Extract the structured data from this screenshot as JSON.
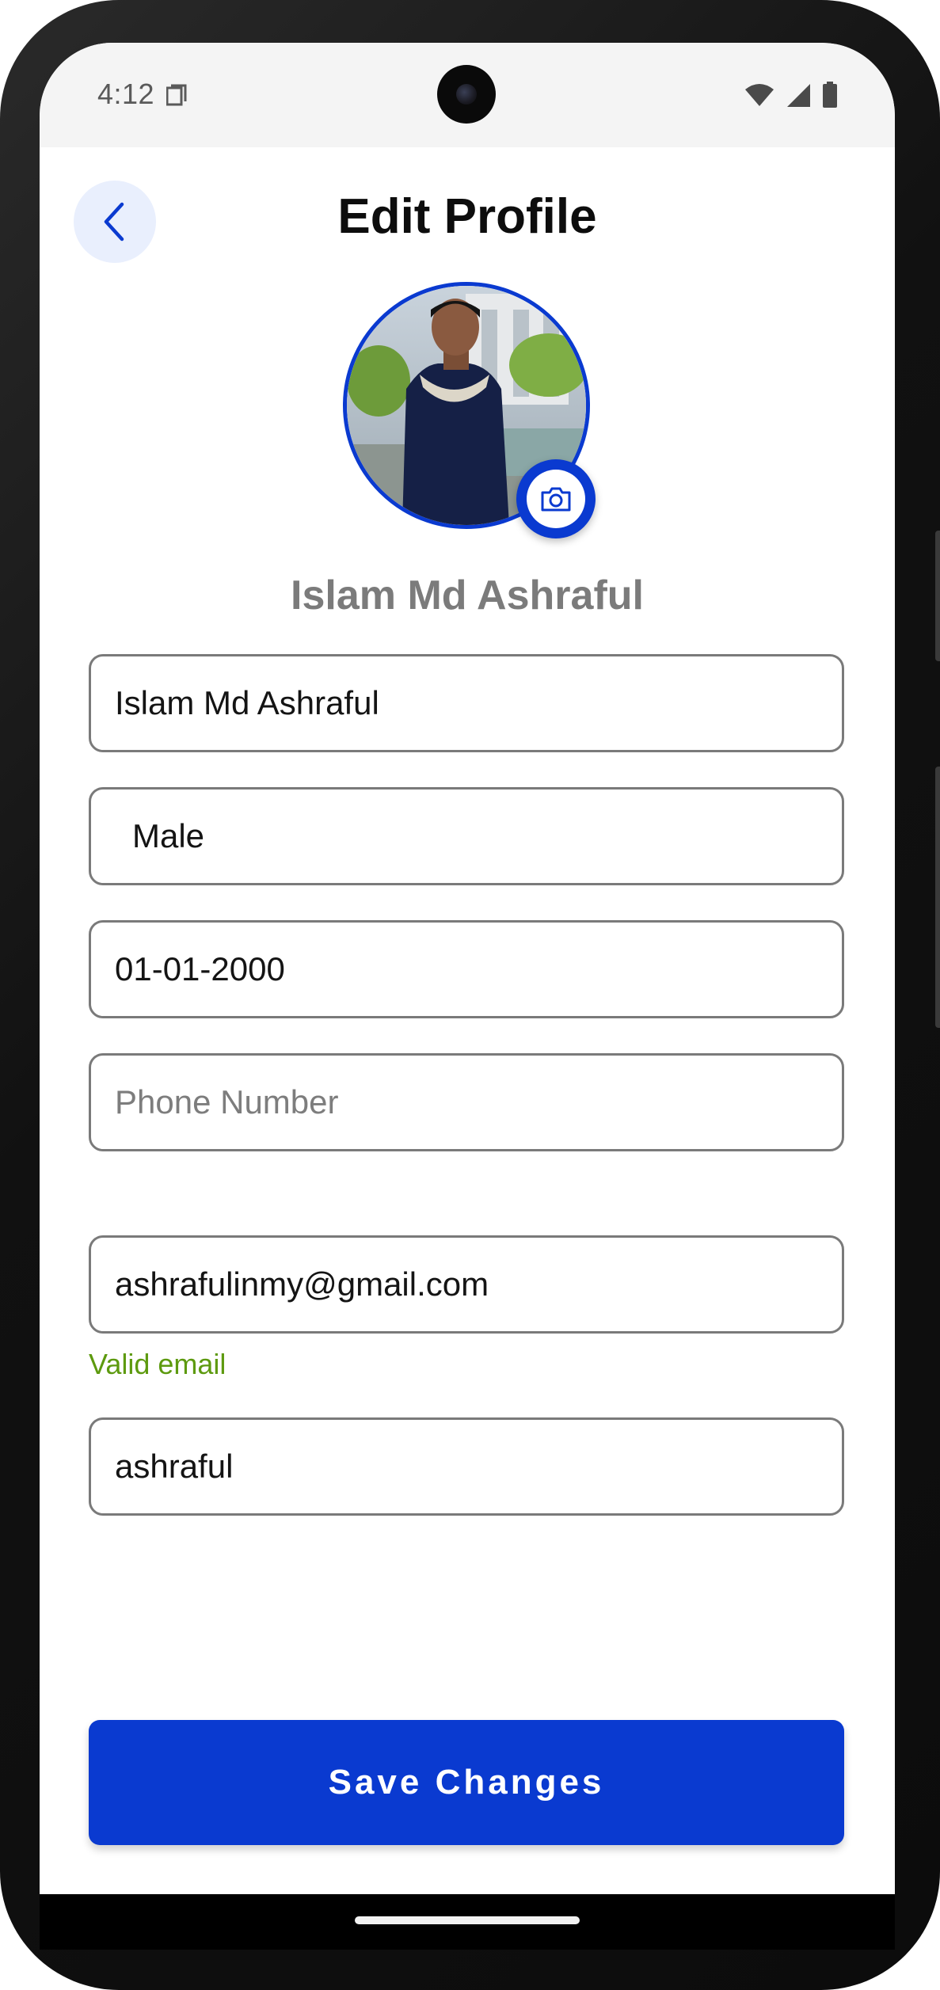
{
  "status_bar": {
    "time": "4:12",
    "icons": [
      "sim-card-icon",
      "wifi-icon",
      "signal-icon",
      "battery-icon"
    ]
  },
  "header": {
    "title": "Edit Profile",
    "back_icon": "chevron-left-icon"
  },
  "profile": {
    "display_name": "Islam Md Ashraful",
    "camera_icon": "camera-icon"
  },
  "form": {
    "name_value": "Islam Md Ashraful",
    "gender_value": "Male",
    "dob_value": "01-01-2000",
    "phone_placeholder": "Phone Number",
    "email_value": "ashrafulinmy@gmail.com",
    "email_helper": "Valid email",
    "username_value": "ashraful"
  },
  "actions": {
    "save_label": "Save Changes"
  },
  "colors": {
    "primary": "#0a3ad0",
    "valid": "#5d9a0f",
    "back_bg": "#e9effd",
    "name_gray": "#7b7b7b"
  }
}
